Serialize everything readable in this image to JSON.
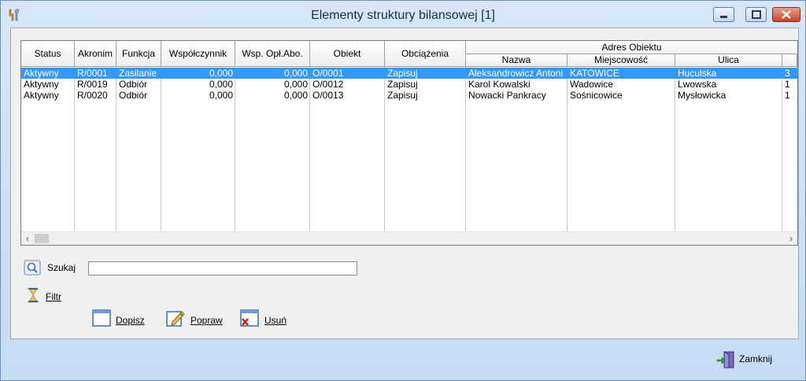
{
  "window": {
    "title": "Elementy struktury bilansowej [1]",
    "controls": [
      "minimize",
      "maximize",
      "close"
    ]
  },
  "grid": {
    "columns": [
      "Status",
      "Akronim",
      "Funkcja",
      "Współczynnik",
      "Wsp. Opł.Abo.",
      "Obiekt",
      "Obciążenia"
    ],
    "group_header": "Adres Obiektu",
    "group_columns": [
      "Nazwa",
      "Miejscowość",
      "Ulica"
    ],
    "rows": [
      {
        "status": "Aktywny",
        "akronim": "R/0001",
        "funkcja": "Zasilanie",
        "wspolczynnik": "0,000",
        "wsp_opl": "0,000",
        "obiekt": "O/0001",
        "obciazenia": "Zapisuj",
        "nazwa": "Aleksandrowicz Antoni",
        "miejscowosc": "KATOWICE",
        "ulica": "Huculska",
        "extra": "3",
        "selected": true
      },
      {
        "status": "Aktywny",
        "akronim": "R/0019",
        "funkcja": "Odbiór",
        "wspolczynnik": "0,000",
        "wsp_opl": "0,000",
        "obiekt": "O/0012",
        "obciazenia": "Zapisuj",
        "nazwa": "Karol Kowalski",
        "miejscowosc": "Wadowice",
        "ulica": "Lwowska",
        "extra": "1",
        "selected": false
      },
      {
        "status": "Aktywny",
        "akronim": "R/0020",
        "funkcja": "Odbiór",
        "wspolczynnik": "0,000",
        "wsp_opl": "0,000",
        "obiekt": "O/0013",
        "obciazenia": "Zapisuj",
        "nazwa": "Nowacki Pankracy",
        "miejscowosc": "Sośnicowice",
        "ulica": "Mysłowicka",
        "extra": "1",
        "selected": false
      }
    ]
  },
  "search": {
    "label": "Szukaj",
    "value": ""
  },
  "filter": {
    "label": "Filtr"
  },
  "actions": {
    "add": "Dopisz",
    "edit": "Popraw",
    "delete": "Usuń"
  },
  "footer": {
    "close": "Zamknij"
  },
  "icons": {
    "app": "tools-icon",
    "search": "magnifier-icon",
    "filter": "hourglass-icon",
    "add": "new-document-icon",
    "edit": "pencil-icon",
    "delete": "delete-icon",
    "close": "exit-door-icon"
  }
}
